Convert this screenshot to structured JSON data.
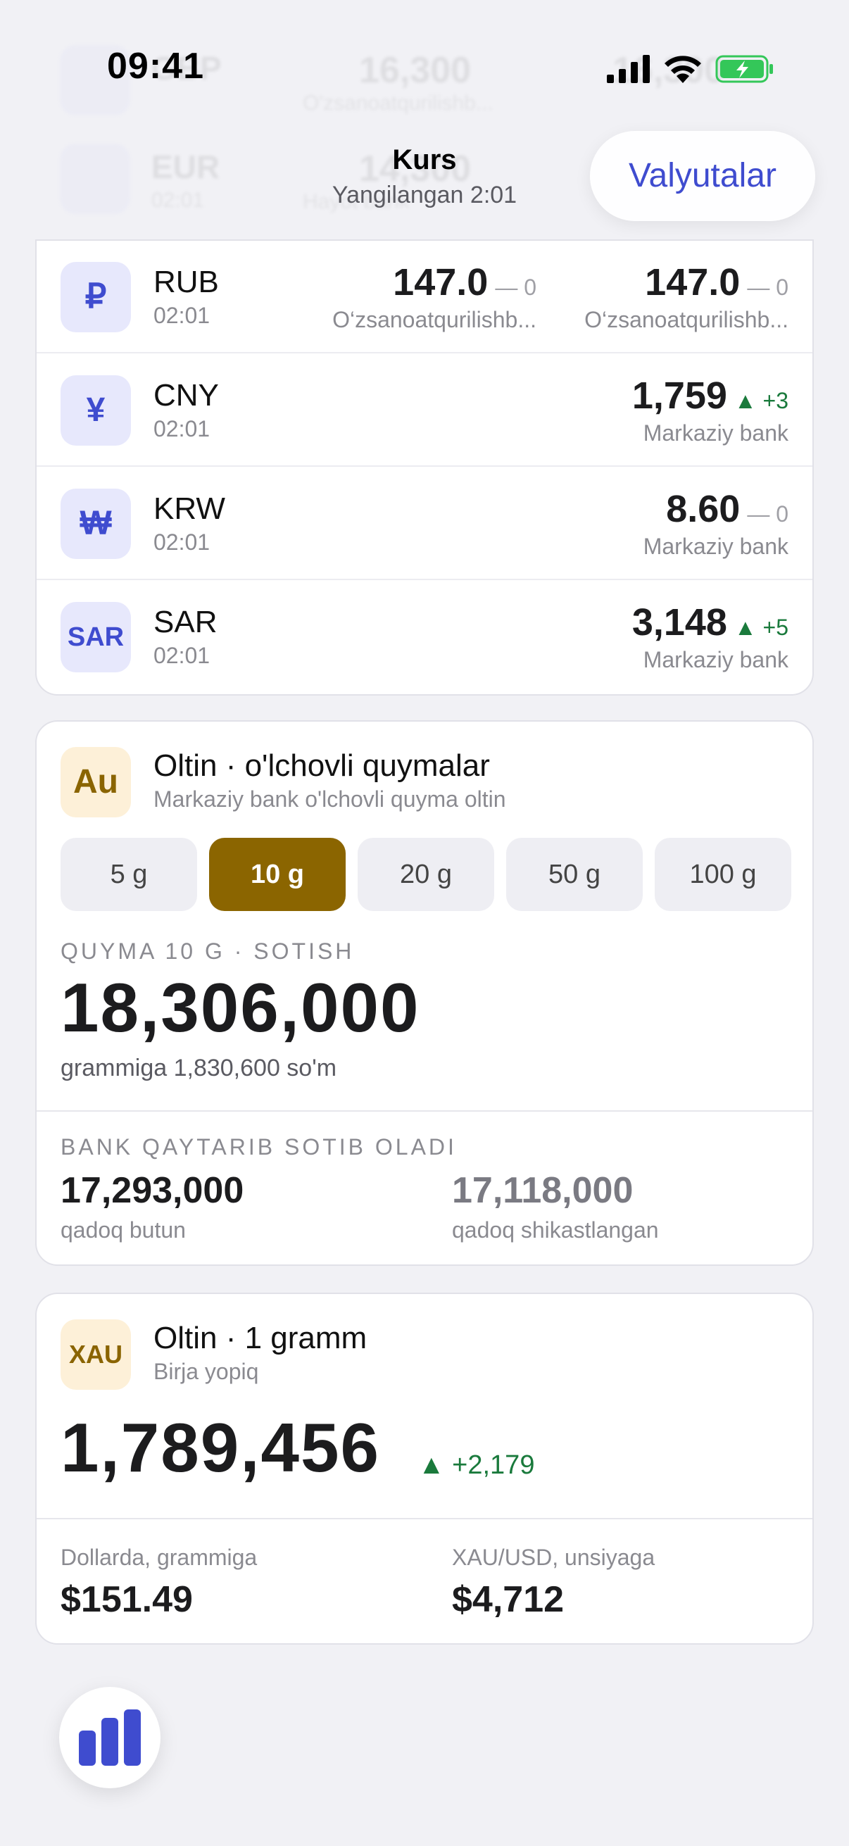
{
  "status_bar": {
    "time": "09:41"
  },
  "header": {
    "title": "Kurs",
    "subtitle": "Yangilangan 2:01",
    "currencies_button": "Valyutalar",
    "ghost_rows": [
      {
        "code": "GBP",
        "time": "02:01",
        "rate1": "16,300",
        "rate2": "16,300",
        "bank1": "O'zsanoatqurilishb..."
      },
      {
        "code": "EUR",
        "time": "02:01",
        "rate1": "14,300",
        "bank1": "Hayot bank"
      }
    ]
  },
  "currencies": [
    {
      "code": "RUB",
      "symbol": "₽",
      "time": "02:01",
      "rates": [
        {
          "value": "147.0",
          "change": "— 0",
          "dir": "zero",
          "bank": "O‘zsanoatqurilishb..."
        },
        {
          "value": "147.0",
          "change": "— 0",
          "dir": "zero",
          "bank": "O‘zsanoatqurilishb..."
        }
      ]
    },
    {
      "code": "CNY",
      "symbol": "¥",
      "time": "02:01",
      "rates": [
        {
          "value": "1,759",
          "change": "▲ +3",
          "dir": "up",
          "bank": "Markaziy bank"
        }
      ]
    },
    {
      "code": "KRW",
      "symbol": "₩",
      "time": "02:01",
      "rates": [
        {
          "value": "8.60",
          "change": "— 0",
          "dir": "zero",
          "bank": "Markaziy bank"
        }
      ]
    },
    {
      "code": "SAR",
      "symbol": "SAR",
      "time": "02:01",
      "rates": [
        {
          "value": "3,148",
          "change": "▲ +5",
          "dir": "up",
          "bank": "Markaziy bank"
        }
      ]
    }
  ],
  "gold_bars": {
    "icon": "Au",
    "title": "Oltin · o'lchovli quymalar",
    "subtitle": "Markaziy bank o'lchovli quyma oltin",
    "weights": [
      "5 g",
      "10 g",
      "20 g",
      "50 g",
      "100 g"
    ],
    "selected_weight": "10 g",
    "section_label": "QUYMA 10 G · SOTISH",
    "price": "18,306,000",
    "per_gram": "grammiga 1,830,600 so'm",
    "buyback_label": "BANK QAYTARIB SOTIB OLADI",
    "buyback_intact_value": "17,293,000",
    "buyback_intact_label": "qadoq butun",
    "buyback_damaged_value": "17,118,000",
    "buyback_damaged_label": "qadoq shikastlangan"
  },
  "gold_gram": {
    "icon": "XAU",
    "title": "Oltin · 1 gramm",
    "subtitle": "Birja yopiq",
    "price": "1,789,456",
    "change": "▲ +2,179",
    "usd_label": "Dollarda, grammiga",
    "usd_value": "$151.49",
    "xauusd_label": "XAU/USD, unsiyaga",
    "xauusd_value": "$4,712"
  },
  "fab": {
    "icon": "bar-chart-icon"
  },
  "colors": {
    "accent": "#3f4ccf",
    "gold": "#8b6500",
    "up": "#1a7a3c"
  }
}
